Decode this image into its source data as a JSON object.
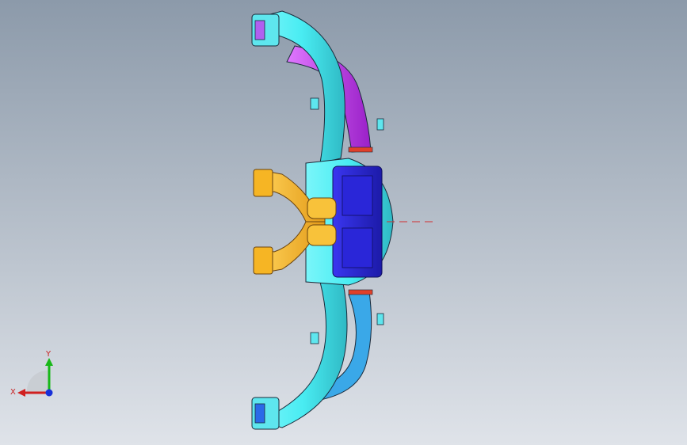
{
  "viewport": {
    "background_top": "#8c9aaa",
    "background_bottom": "#dfe3e9"
  },
  "model": {
    "colors": {
      "duct_cyan": "#49ecf2",
      "duct_cyan_dark": "#2fb9c4",
      "duct_magenta": "#c23ef0",
      "center_blue": "#2a26d8",
      "center_blue_dark": "#1a1890",
      "branch_gold": "#f6b524",
      "branch_gold_dark": "#c78512",
      "edge": "#1a2a3a",
      "red_flange": "#e0402a"
    }
  },
  "triad": {
    "x_label": "X",
    "y_label": "Y",
    "x_color": "#d02020",
    "y_color": "#18b818",
    "z_color": "#1830d8"
  }
}
